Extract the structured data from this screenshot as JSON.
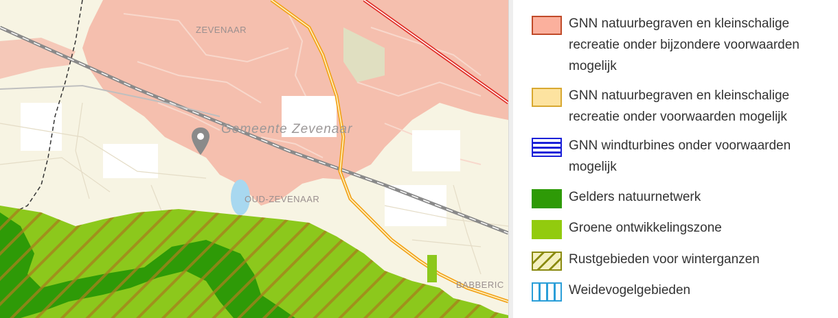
{
  "map": {
    "labels": {
      "zevenaar": "ZEVENAAR",
      "gemeente": "Gemeente  Zevenaar",
      "oud_zevenaar": "OUD-ZEVENAAR",
      "babberich": "BABBERIC"
    },
    "marker_icon": "map-pin-icon",
    "colors": {
      "urban": "#f5bfae",
      "rural": "#f7f4e3",
      "rail": "#8a8a8a",
      "road": "#f2a21a",
      "natuurnetwerk": "#2e9a07",
      "ontwikkelingszone": "#8cc81c"
    }
  },
  "legend": {
    "items": [
      {
        "label_lines": [
          "GNN natuurbegraven en kleinschalige",
          "recreatie onder bijzondere voorwaarden",
          "mogelijk"
        ],
        "fill": "#fbb09d",
        "border": "#c04a28",
        "pattern": "solid"
      },
      {
        "label_lines": [
          "GNN natuurbegraven en kleinschalige",
          "recreatie onder voorwaarden mogelijk"
        ],
        "fill": "#fde3a0",
        "border": "#d8a830",
        "pattern": "solid"
      },
      {
        "label_lines": [
          "GNN windturbines onder voorwaarden",
          "mogelijk"
        ],
        "fill": "#ffffff",
        "border": "#1a20d8",
        "pattern": "horizontal-lines"
      },
      {
        "label_lines": [
          "Gelders natuurnetwerk"
        ],
        "fill": "#2e9a07",
        "border": "#2e9a07",
        "pattern": "solid"
      },
      {
        "label_lines": [
          "Groene ontwikkelingszone"
        ],
        "fill": "#92cb0e",
        "border": "#92cb0e",
        "pattern": "solid"
      },
      {
        "label_lines": [
          "Rustgebieden voor winterganzen"
        ],
        "fill": "#ffffff",
        "border": "#8a8a10",
        "pattern": "diagonal-hatch"
      },
      {
        "label_lines": [
          "Weidevogelgebieden"
        ],
        "fill": "#ffffff",
        "border": "#2a9ed8",
        "pattern": "vertical-lines"
      }
    ]
  }
}
